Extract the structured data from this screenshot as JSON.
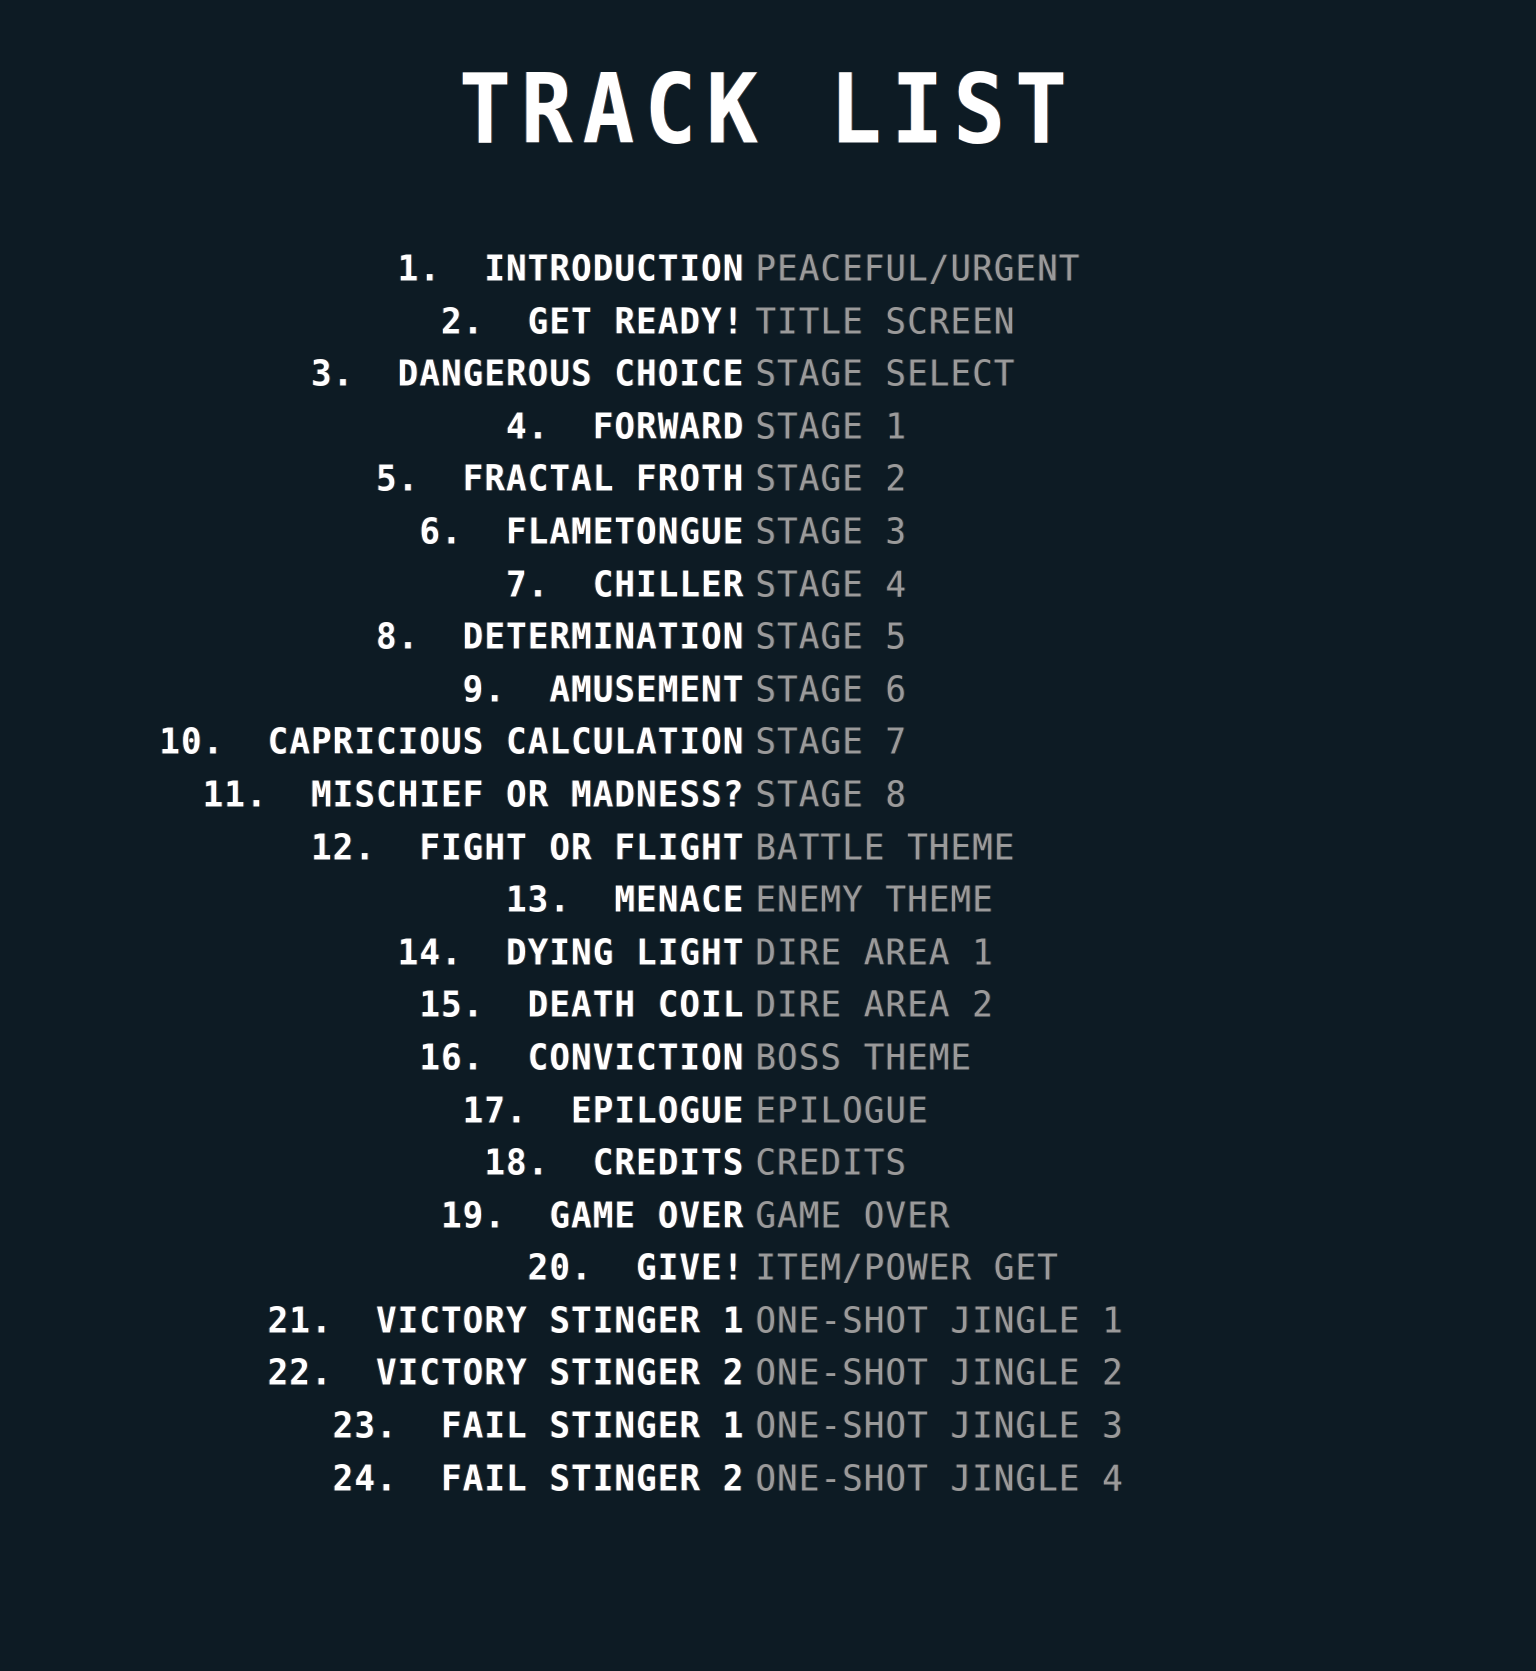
{
  "screen": {
    "title": "TRACK LIST",
    "background_color": "#0d1b24",
    "primary_text_color": "#ffffff",
    "secondary_text_color": "#9a9a9a"
  },
  "tracks": [
    {
      "number": "1.",
      "title": "INTRODUCTION",
      "context": "PEACEFUL/URGENT"
    },
    {
      "number": "2.",
      "title": "GET READY!",
      "context": "TITLE SCREEN"
    },
    {
      "number": "3.",
      "title": "DANGEROUS CHOICE",
      "context": "STAGE SELECT"
    },
    {
      "number": "4.",
      "title": "FORWARD",
      "context": "STAGE 1"
    },
    {
      "number": "5.",
      "title": "FRACTAL FROTH",
      "context": "STAGE 2"
    },
    {
      "number": "6.",
      "title": "FLAMETONGUE",
      "context": "STAGE 3"
    },
    {
      "number": "7.",
      "title": "CHILLER",
      "context": "STAGE 4"
    },
    {
      "number": "8.",
      "title": "DETERMINATION",
      "context": "STAGE 5"
    },
    {
      "number": "9.",
      "title": "AMUSEMENT",
      "context": "STAGE 6"
    },
    {
      "number": "10.",
      "title": "CAPRICIOUS CALCULATION",
      "context": "STAGE 7"
    },
    {
      "number": "11.",
      "title": "MISCHIEF OR MADNESS?",
      "context": "STAGE 8"
    },
    {
      "number": "12.",
      "title": "FIGHT OR FLIGHT",
      "context": "BATTLE THEME"
    },
    {
      "number": "13.",
      "title": "MENACE",
      "context": "ENEMY THEME"
    },
    {
      "number": "14.",
      "title": "DYING LIGHT",
      "context": "DIRE AREA 1"
    },
    {
      "number": "15.",
      "title": "DEATH COIL",
      "context": "DIRE AREA 2"
    },
    {
      "number": "16.",
      "title": "CONVICTION",
      "context": "BOSS THEME"
    },
    {
      "number": "17.",
      "title": "EPILOGUE",
      "context": "EPILOGUE"
    },
    {
      "number": "18.",
      "title": "CREDITS",
      "context": "CREDITS"
    },
    {
      "number": "19.",
      "title": "GAME OVER",
      "context": "GAME OVER"
    },
    {
      "number": "20.",
      "title": "GIVE!",
      "context": "ITEM/POWER GET"
    },
    {
      "number": "21.",
      "title": "VICTORY STINGER 1",
      "context": "ONE-SHOT JINGLE 1"
    },
    {
      "number": "22.",
      "title": "VICTORY STINGER 2",
      "context": "ONE-SHOT JINGLE 2"
    },
    {
      "number": "23.",
      "title": "FAIL STINGER 1",
      "context": "ONE-SHOT JINGLE 3"
    },
    {
      "number": "24.",
      "title": "FAIL STINGER 2",
      "context": "ONE-SHOT JINGLE 4"
    }
  ]
}
